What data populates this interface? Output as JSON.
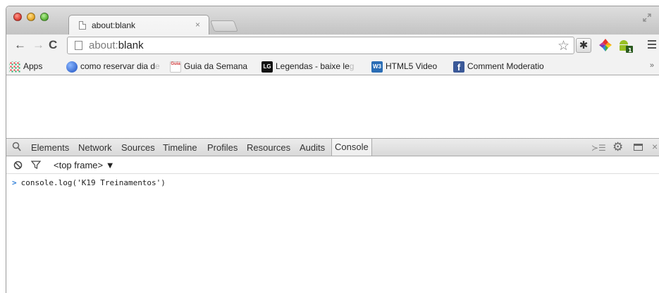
{
  "tab": {
    "title": "about:blank",
    "close_glyph": "×"
  },
  "toolbar": {
    "back_glyph": "←",
    "forward_glyph": "→",
    "reload_glyph": "C",
    "url_prefix": "about:",
    "url_host": "blank",
    "star_glyph": "☆"
  },
  "bookmarks": {
    "items": [
      {
        "label": "Apps",
        "fade": "",
        "icon": "apps-grid-icon"
      },
      {
        "label": "como reservar dia d",
        "fade": "e",
        "icon": "globe-icon"
      },
      {
        "label": "Guia da Semana",
        "fade": "",
        "icon": "guia-favicon-icon"
      },
      {
        "label": "Legendas - baixe le",
        "fade": "g",
        "icon": "legendas-favicon-icon"
      },
      {
        "label": "HTML5 Video",
        "fade": "",
        "icon": "w3-favicon-icon"
      },
      {
        "label": "Comment Moderatio",
        "fade": "",
        "icon": "facebook-icon"
      }
    ],
    "overflow_glyph": "»"
  },
  "devtools": {
    "tabs": [
      "Elements",
      "Network",
      "Sources",
      "Timeline",
      "Profiles",
      "Resources",
      "Audits",
      "Console"
    ],
    "active_tab": "Console",
    "frame_selector": "<top frame> ▼"
  },
  "console": {
    "entry": "console.log('K19 Treinamentos')",
    "prompt_glyph": ">"
  },
  "colors": {
    "prompt_caret": "#2f7fd8",
    "tab_strip": "#c3c3c3",
    "toolbar": "#f2f2f2"
  }
}
